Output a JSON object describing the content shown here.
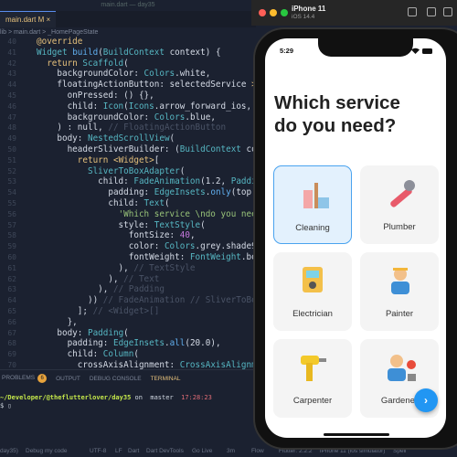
{
  "editor": {
    "window_title": "main.dart — day35",
    "tab": "main.dart M ×",
    "breadcrumb": "lib > main.dart > _HomePageState",
    "lines": [
      {
        "n": "40",
        "t": [
          [
            "@override",
            "k"
          ]
        ]
      },
      {
        "n": "41",
        "t": [
          [
            "Widget ",
            "c"
          ],
          [
            "build",
            "f"
          ],
          [
            "(",
            "p"
          ],
          [
            "BuildContext",
            "c"
          ],
          [
            " context) {",
            "p"
          ]
        ]
      },
      {
        "n": "42",
        "t": [
          [
            "  return ",
            "k"
          ],
          [
            "Scaffold",
            "c"
          ],
          [
            "(",
            "p"
          ]
        ]
      },
      {
        "n": "43",
        "t": [
          [
            "    backgroundColor: ",
            "p"
          ],
          [
            "Colors",
            "c"
          ],
          [
            ".white,",
            "p"
          ]
        ]
      },
      {
        "n": "44",
        "t": [
          [
            "    floatingActionButton: selectedService ",
            "p"
          ],
          [
            ">=",
            "k"
          ],
          [
            " 0 ? ",
            "p"
          ]
        ]
      },
      {
        "n": "45",
        "t": [
          [
            "      onPressed: () {},",
            "p"
          ]
        ]
      },
      {
        "n": "46",
        "t": [
          [
            "      child: ",
            "p"
          ],
          [
            "Icon",
            "c"
          ],
          [
            "(",
            "p"
          ],
          [
            "Icons",
            "c"
          ],
          [
            ".arrow_forward_ios, size: 2",
            "p"
          ]
        ]
      },
      {
        "n": "47",
        "t": [
          [
            "      backgroundColor: ",
            "p"
          ],
          [
            "Colors",
            "c"
          ],
          [
            ".blue,",
            "p"
          ]
        ]
      },
      {
        "n": "48",
        "t": [
          [
            "    ) : null, ",
            "p"
          ],
          [
            "// FloatingActionButton",
            "m"
          ]
        ]
      },
      {
        "n": "49",
        "t": [
          [
            "    body: ",
            "p"
          ],
          [
            "NestedScrollView",
            "c"
          ],
          [
            "(",
            "p"
          ]
        ]
      },
      {
        "n": "50",
        "t": [
          [
            "      headerSliverBuilder: (",
            "p"
          ],
          [
            "BuildContext",
            "c"
          ],
          [
            " context, ",
            "p"
          ]
        ]
      },
      {
        "n": "51",
        "t": [
          [
            "        return ",
            "k"
          ],
          [
            "<Widget>",
            "k"
          ],
          [
            "[",
            "p"
          ]
        ]
      },
      {
        "n": "52",
        "t": [
          [
            "          SliverToBoxAdapter",
            "c"
          ],
          [
            "(",
            "p"
          ]
        ]
      },
      {
        "n": "53",
        "t": [
          [
            "            child: ",
            "p"
          ],
          [
            "FadeAnimation",
            "c"
          ],
          [
            "(1.2, ",
            "p"
          ],
          [
            "Padding",
            "c"
          ],
          [
            "(",
            "p"
          ]
        ]
      },
      {
        "n": "54",
        "t": [
          [
            "              padding: ",
            "p"
          ],
          [
            "EdgeInsets",
            "c"
          ],
          [
            ".",
            "p"
          ],
          [
            "only",
            "f"
          ],
          [
            "(top: 120.0,",
            "p"
          ]
        ]
      },
      {
        "n": "55",
        "t": [
          [
            "              child: ",
            "p"
          ],
          [
            "Text",
            "c"
          ],
          [
            "(",
            "p"
          ]
        ]
      },
      {
        "n": "56",
        "t": [
          [
            "                'Which service \\ndo you need?'",
            "s"
          ],
          [
            ",",
            "p"
          ]
        ]
      },
      {
        "n": "57",
        "t": [
          [
            "                style: ",
            "p"
          ],
          [
            "TextStyle",
            "c"
          ],
          [
            "(",
            "p"
          ]
        ]
      },
      {
        "n": "58",
        "t": [
          [
            "                  fontSize: ",
            "p"
          ],
          [
            "40",
            "n"
          ],
          [
            ",",
            "p"
          ]
        ]
      },
      {
        "n": "59",
        "t": [
          [
            "                  color: ",
            "p"
          ],
          [
            "Colors",
            "c"
          ],
          [
            ".grey.shade900,",
            "p"
          ]
        ]
      },
      {
        "n": "60",
        "t": [
          [
            "                  fontWeight: ",
            "p"
          ],
          [
            "FontWeight",
            "c"
          ],
          [
            ".bold,",
            "p"
          ]
        ]
      },
      {
        "n": "61",
        "t": [
          [
            "                ), ",
            "p"
          ],
          [
            "// TextStyle",
            "m"
          ]
        ]
      },
      {
        "n": "62",
        "t": [
          [
            "              ), ",
            "p"
          ],
          [
            "// Text",
            "m"
          ]
        ]
      },
      {
        "n": "63",
        "t": [
          [
            "            ), ",
            "p"
          ],
          [
            "// Padding",
            "m"
          ]
        ]
      },
      {
        "n": "64",
        "t": [
          [
            "          )) ",
            "p"
          ],
          [
            "// FadeAnimation // SliverToBoxAdapter",
            "m"
          ]
        ]
      },
      {
        "n": "65",
        "t": [
          [
            "        ]; ",
            "p"
          ],
          [
            "// <Widget>[]",
            "m"
          ]
        ]
      },
      {
        "n": "66",
        "t": [
          [
            "      },",
            "p"
          ]
        ]
      },
      {
        "n": "67",
        "t": [
          [
            "    body: ",
            "p"
          ],
          [
            "Padding",
            "c"
          ],
          [
            "(",
            "p"
          ]
        ]
      },
      {
        "n": "68",
        "t": [
          [
            "      padding: ",
            "p"
          ],
          [
            "EdgeInsets",
            "c"
          ],
          [
            ".",
            "p"
          ],
          [
            "all",
            "f"
          ],
          [
            "(20.0),",
            "p"
          ]
        ]
      },
      {
        "n": "69",
        "t": [
          [
            "      child: ",
            "p"
          ],
          [
            "Column",
            "c"
          ],
          [
            "(",
            "p"
          ]
        ]
      },
      {
        "n": "70",
        "t": [
          [
            "        crossAxisAlignment: ",
            "p"
          ],
          [
            "CrossAxisAlignment",
            "c"
          ],
          [
            ".s",
            "p"
          ]
        ]
      }
    ]
  },
  "panel": {
    "tabs": [
      "PROBLEMS",
      "OUTPUT",
      "DEBUG CONSOLE",
      "TERMINAL"
    ],
    "problems_count": "6",
    "terminal_path": "~/Developer/@theflutterlover/day35",
    "terminal_on": " on  ",
    "branch": "master",
    "time": "17:28:23",
    "prompt": "$ ▯"
  },
  "statusbar": [
    "day35)",
    "Debug my code",
    "UTF-8",
    "LF",
    "Dart",
    "Dart DevTools",
    "Go Live",
    "3m",
    "Flow",
    "Flutter: 2.2.2",
    "iPhone 11 (ios simulator)",
    "Spell"
  ],
  "simulator": {
    "device": "iPhone 11",
    "os": "iOS 14.4"
  },
  "app": {
    "time": "5:29",
    "heading": "Which service\ndo you need?",
    "services": [
      {
        "label": "Cleaning",
        "selected": true
      },
      {
        "label": "Plumber"
      },
      {
        "label": "Electrician"
      },
      {
        "label": "Painter"
      },
      {
        "label": "Carpenter"
      },
      {
        "label": "Gardener"
      }
    ],
    "fab_icon": "arrow-forward-icon",
    "accent": "#2196f3"
  }
}
